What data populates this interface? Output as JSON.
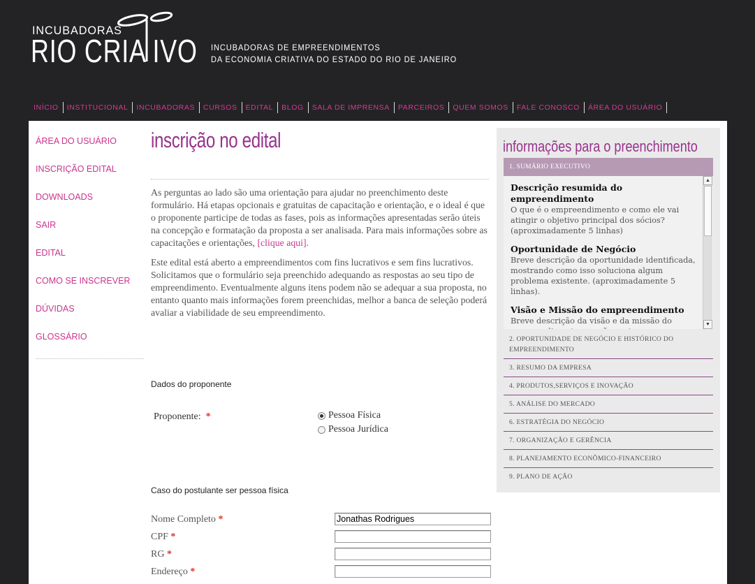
{
  "header": {
    "logo_small": "INCUBADORAS",
    "logo_big": "RIO CRIA IVO",
    "tagline_line1": "INCUBADORAS DE EMPREENDIMENTOS",
    "tagline_line2": "DA ECONOMIA CRIATIVA DO ESTADO DO RIO DE JANEIRO"
  },
  "nav": {
    "items": [
      "INÍCIO",
      "INSTITUCIONAL",
      "INCUBADORAS",
      "CURSOS",
      "EDITAL",
      "BLOG",
      "SALA DE IMPRENSA",
      "PARCEIROS",
      "QUEM SOMOS",
      "FALE CONOSCO",
      "ÁREA DO USUÁRIO"
    ]
  },
  "sidebar": {
    "items": [
      "ÁREA DO USUÁRIO",
      "INSCRIÇÃO EDITAL",
      "DOWNLOADS",
      "SAIR",
      "EDITAL",
      "COMO SE INSCREVER",
      "DÚVIDAS",
      "GLOSSÁRIO"
    ]
  },
  "main": {
    "title": "inscrição no edital",
    "intro_p1": "As perguntas ao lado são uma orientação para ajudar no preenchimento deste formulário. Há etapas opcionais e gratuitas de capacitação e orientação, e o ideal é que o proponente participe de todas as fases, pois as informações apresentadas serão úteis na concepção e formatação da proposta a ser analisada. Para mais informações sobre as capacitações e orientações,",
    "intro_link": "[clique aqui].",
    "intro_p2": "Este edital está aberto a empreendimentos com fins lucrativos e sem fins lucrativos. Solicitamos que o formulário seja preenchido adequando as respostas ao seu tipo de empreendimento. Eventualmente alguns itens podem não se adequar a sua proposta, no entanto quanto mais informações forem preenchidas, melhor a banca de seleção poderá avaliar a viabilidade de seu empreendimento.",
    "section_proponente": "Dados do proponente",
    "proponente_label": "Proponente:",
    "required_mark": "*",
    "radio_fisica": "Pessoa Física",
    "radio_juridica": "Pessoa Jurídica",
    "radio_selected": "Pessoa Física",
    "section_fisica": "Caso do postulante ser pessoa física",
    "fields": [
      {
        "label": "Nome Completo",
        "value": "Jonathas Rodrigues"
      },
      {
        "label": "CPF",
        "value": ""
      },
      {
        "label": "RG",
        "value": ""
      },
      {
        "label": "Endereço",
        "value": ""
      }
    ]
  },
  "right_panel": {
    "title": "informações para o preenchimento",
    "active_section": "1. SUMÁRIO EXECUTIVO",
    "active_items": [
      {
        "heading": "Descrição resumida do empreendimento",
        "body": "O que é o empreendimento e como ele vai atingir o objetivo principal dos sócios? (aproximadamente 5 linhas)"
      },
      {
        "heading": "Oportunidade de Negócio",
        "body": "Breve descrição da oportunidade identificada, mostrando como isso soluciona algum problema existente. (aproximadamente 5 linhas)."
      },
      {
        "heading": "Visão e Missão do empreendimento",
        "body": "Breve descrição da visão e da missão do empreendimento que vão nortear o planejamento e gestão do empreendimento"
      }
    ],
    "sections": [
      "2. OPORTUNIDADE DE NEGÓCIO E HISTÓRICO DO EMPREENDIMENTO",
      "3. RESUMO DA EMPRESA",
      "4. PRODUTOS,SERVIÇOS E INOVAÇÃO",
      "5. ANÁLISE DO MERCADO",
      "6. ESTRATÉGIA DO NEGÓCIO",
      "7. ORGANIZAÇÃO E GERÊNCIA",
      "8. PLANEJAMENTO ECONÔMICO-FINANCEIRO",
      "9. PLANO DE AÇÃO"
    ]
  },
  "colors": {
    "header_bg": "#232325",
    "accent_pink": "#c9358c",
    "accent_purple": "#97338c",
    "active_section_bg": "#b69ab4"
  }
}
